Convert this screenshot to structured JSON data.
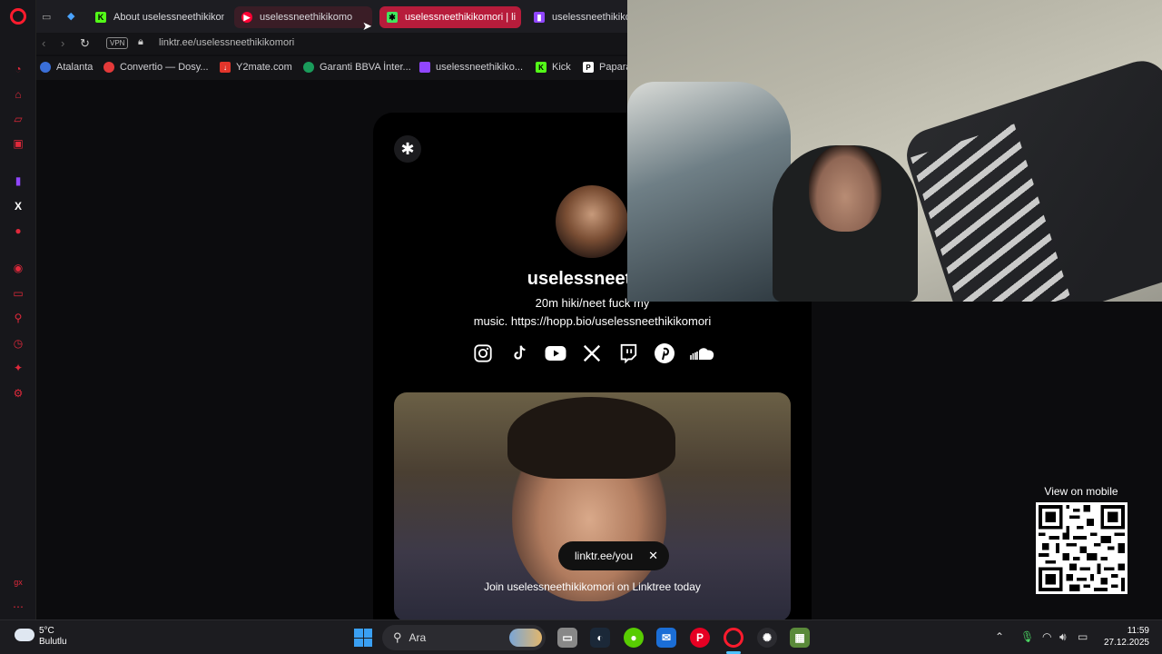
{
  "browser": {
    "tabs": [
      {
        "label": "About uselessneethikikom",
        "favicon": "kick-favicon"
      },
      {
        "label": "uselessneethikikomo",
        "favicon": "youtube-favicon"
      },
      {
        "label": "uselessneethikikomori | li",
        "favicon": "linktree-favicon"
      },
      {
        "label": "uselessneethikikom",
        "favicon": "twitch-favicon"
      }
    ],
    "url": "linktr.ee/uselessneethikikomori",
    "vpn_label": "VPN"
  },
  "bookmarks": [
    {
      "label": "Atalanta",
      "color": "#3a6fd8"
    },
    {
      "label": "Convertio — Dosy...",
      "color": "#e43a3a"
    },
    {
      "label": "Y2mate.com",
      "color": "#e2352b"
    },
    {
      "label": "Garanti BBVA İnter...",
      "color": "#1a9c5b"
    },
    {
      "label": "uselessneethikiko...",
      "color": "#9146ff"
    },
    {
      "label": "Kick",
      "color": "#53fc18"
    },
    {
      "label": "Papara",
      "color": "#ffffff"
    }
  ],
  "profile": {
    "name": "uselessneethik",
    "bio_line1": "20m hiki/neet fuck my",
    "bio_line2": "music. https://hopp.bio/uselessneethikikomori",
    "chip_text": "linktr.ee/you",
    "join_text": "Join uselessneethikikomori on Linktree today"
  },
  "socials": [
    "instagram-icon",
    "tiktok-icon",
    "youtube-icon",
    "x-icon",
    "twitch-icon",
    "pinterest-icon",
    "soundcloud-icon"
  ],
  "qr": {
    "title": "View on mobile"
  },
  "taskbar": {
    "weather_temp": "5°C",
    "weather_desc": "Bulutlu",
    "search_placeholder": "Ara",
    "time": "11:59",
    "date": "27.12.2025"
  },
  "colors": {
    "opera_red": "#ff1b2d",
    "accent_blue": "#4cc2ff"
  }
}
